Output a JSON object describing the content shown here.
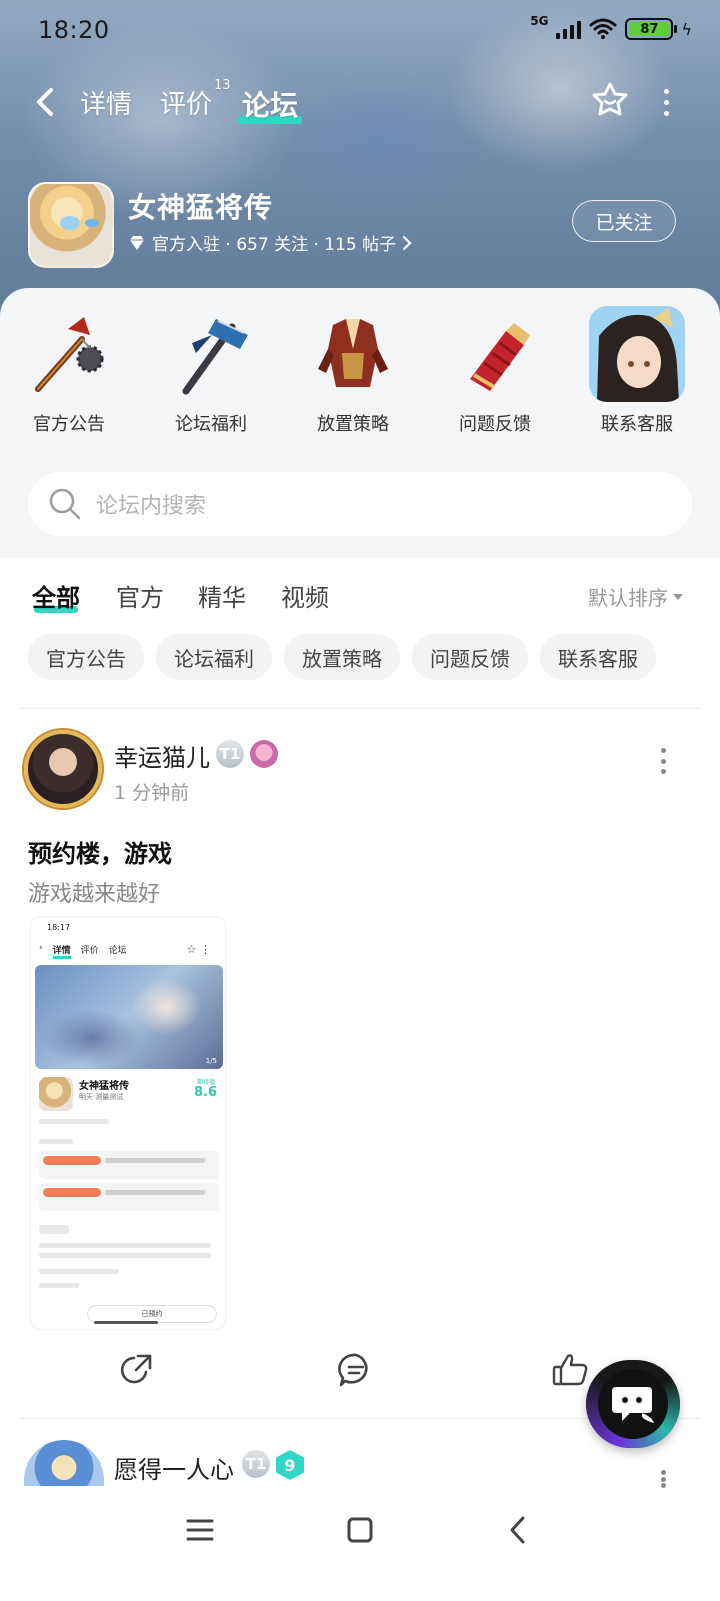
{
  "status_bar": {
    "time": "18:20",
    "network": "5G",
    "battery": "87"
  },
  "nav": {
    "tabs": [
      {
        "label": "详情"
      },
      {
        "label": "评价",
        "badge": "13"
      },
      {
        "label": "论坛"
      }
    ],
    "active_tab": "论坛"
  },
  "game": {
    "name": "女神猛将传",
    "meta": "官方入驻 · 657 关注 · 115 帖子",
    "follow_button": "已关注"
  },
  "categories": [
    {
      "label": "官方公告",
      "icon": "mace-icon"
    },
    {
      "label": "论坛福利",
      "icon": "hammer-icon"
    },
    {
      "label": "放置策略",
      "icon": "armor-icon"
    },
    {
      "label": "问题反馈",
      "icon": "gauntlet-icon"
    },
    {
      "label": "联系客服",
      "icon": "character-avatar-icon"
    }
  ],
  "search": {
    "placeholder": "论坛内搜索"
  },
  "filter_tabs": [
    {
      "label": "全部"
    },
    {
      "label": "官方"
    },
    {
      "label": "精华"
    },
    {
      "label": "视频"
    }
  ],
  "sort_label": "默认排序",
  "chips": [
    "官方公告",
    "论坛福利",
    "放置策略",
    "问题反馈",
    "联系客服"
  ],
  "posts": [
    {
      "author": "幸运猫儿",
      "level_badge": "T1",
      "time": "1 分钟前",
      "title": "预约楼，游戏",
      "body": "游戏越来越好",
      "thumbnail": {
        "time": "18:17",
        "tabs": [
          "详情",
          "评价",
          "论坛"
        ],
        "game_name": "女神猛将传",
        "subtitle": "明天 测量测试",
        "score_label": "期待值",
        "score": "8.6",
        "pager": "1/5",
        "follow_label": "已预约"
      }
    },
    {
      "author": "愿得一人心",
      "level_badge": "T1",
      "rank_badge": "9"
    }
  ],
  "colors": {
    "accent": "#2fd7c4",
    "text_primary": "#222222",
    "text_secondary": "#999999",
    "chip_bg": "#f2f3f5"
  }
}
